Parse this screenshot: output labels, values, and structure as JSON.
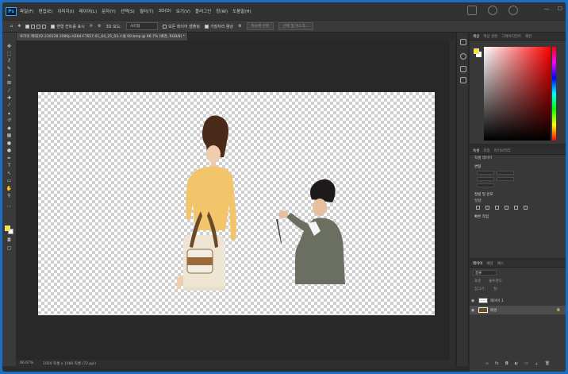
{
  "app": {
    "logo": "Ps"
  },
  "menu": [
    "파일(F)",
    "편집(E)",
    "이미지(I)",
    "레이어(L)",
    "문자(Y)",
    "선택(S)",
    "필터(T)",
    "3D(D)",
    "보기(V)",
    "플러그인",
    "창(W)",
    "도움말(H)"
  ],
  "options": {
    "auto_select": "자동 선택:",
    "layer": "레이어",
    "show_transform": "변형 컨트롤 표시",
    "mode": "3D 모드:",
    "align_label": "정렬",
    "same_frame": "모든 레이어 샘플링",
    "enhance_edge": "가장자리 향상",
    "select_subject": "피사체 선택",
    "select_mask": "선택 및 마스크...",
    "shape_select": "사각형"
  },
  "document": {
    "tab_title": "루카의 캐릭[02.230128.1080p.H264-F7657.01_04_25_03.스윗 00.bmp @ 66.7% (배경, RGB/8) *",
    "zoom": "66.67%",
    "doc_info": "1920 픽셀 x 1080 픽셀 (72 ppi)"
  },
  "color_panel": {
    "tabs": [
      "색상",
      "색상 견본",
      "그레이디언트",
      "패턴"
    ],
    "fg_color": "#ffe800",
    "bg_color": "#ffffff"
  },
  "properties_panel": {
    "tabs": [
      "속성",
      "조정",
      "라이브러리"
    ],
    "layer_kind": "픽셀 레이어",
    "transform": "변형",
    "align": "정렬 및 분포",
    "align_sub": "정렬:",
    "quick_actions": "빠른 작업"
  },
  "layers_panel": {
    "tabs": [
      "레이어",
      "채널",
      "패스"
    ],
    "kind": "종류",
    "normal": "표준",
    "opacity": "불투명도:",
    "lock": "잠그기:",
    "fill": "칠:",
    "layers": [
      {
        "name": "레이어 1"
      },
      {
        "name": "배경"
      }
    ]
  }
}
